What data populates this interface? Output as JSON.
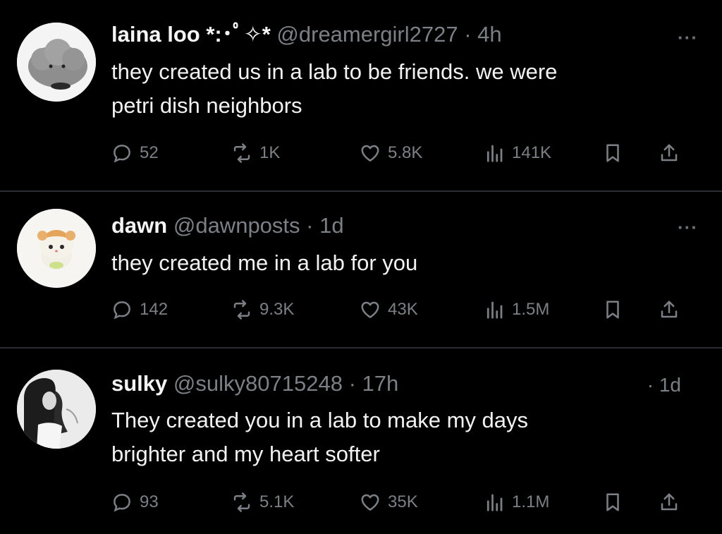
{
  "colors": {
    "background": "#000000",
    "text": "#e7e9ea",
    "secondary": "#7b8086",
    "divider": "#2a2d31"
  },
  "posts": [
    {
      "name": "laina loo *:･ﾟ✧*",
      "handle": "@dreamergirl2727",
      "time": "· 4h",
      "avatar_icon": "grey-plush-avatar",
      "more_icon": "more-dots-icon",
      "lines": [
        "they created us in a lab to be friends. we were",
        "petri dish neighbors"
      ],
      "stats": {
        "replies": "52",
        "reposts": "1K",
        "likes": "5.8K",
        "views": "141K"
      }
    },
    {
      "name": "dawn",
      "handle": "@dawnposts",
      "time": "· 1d",
      "avatar_icon": "hamster-avatar",
      "more_icon": "more-dots-icon",
      "lines": [
        "they created me in a lab for you"
      ],
      "stats": {
        "replies": "142",
        "reposts": "9.3K",
        "likes": "43K",
        "views": "1.5M"
      }
    },
    {
      "name": "sulky",
      "handle": "@sulky80715248",
      "time": "· 17h",
      "side_time": "· 1d",
      "avatar_icon": "portrait-avatar",
      "lines": [
        "They created you in a lab to make my days",
        "brighter and my heart softer"
      ],
      "stats": {
        "replies": "93",
        "reposts": "5.1K",
        "likes": "35K",
        "views": "1.1M"
      }
    }
  ],
  "more_label": "···"
}
